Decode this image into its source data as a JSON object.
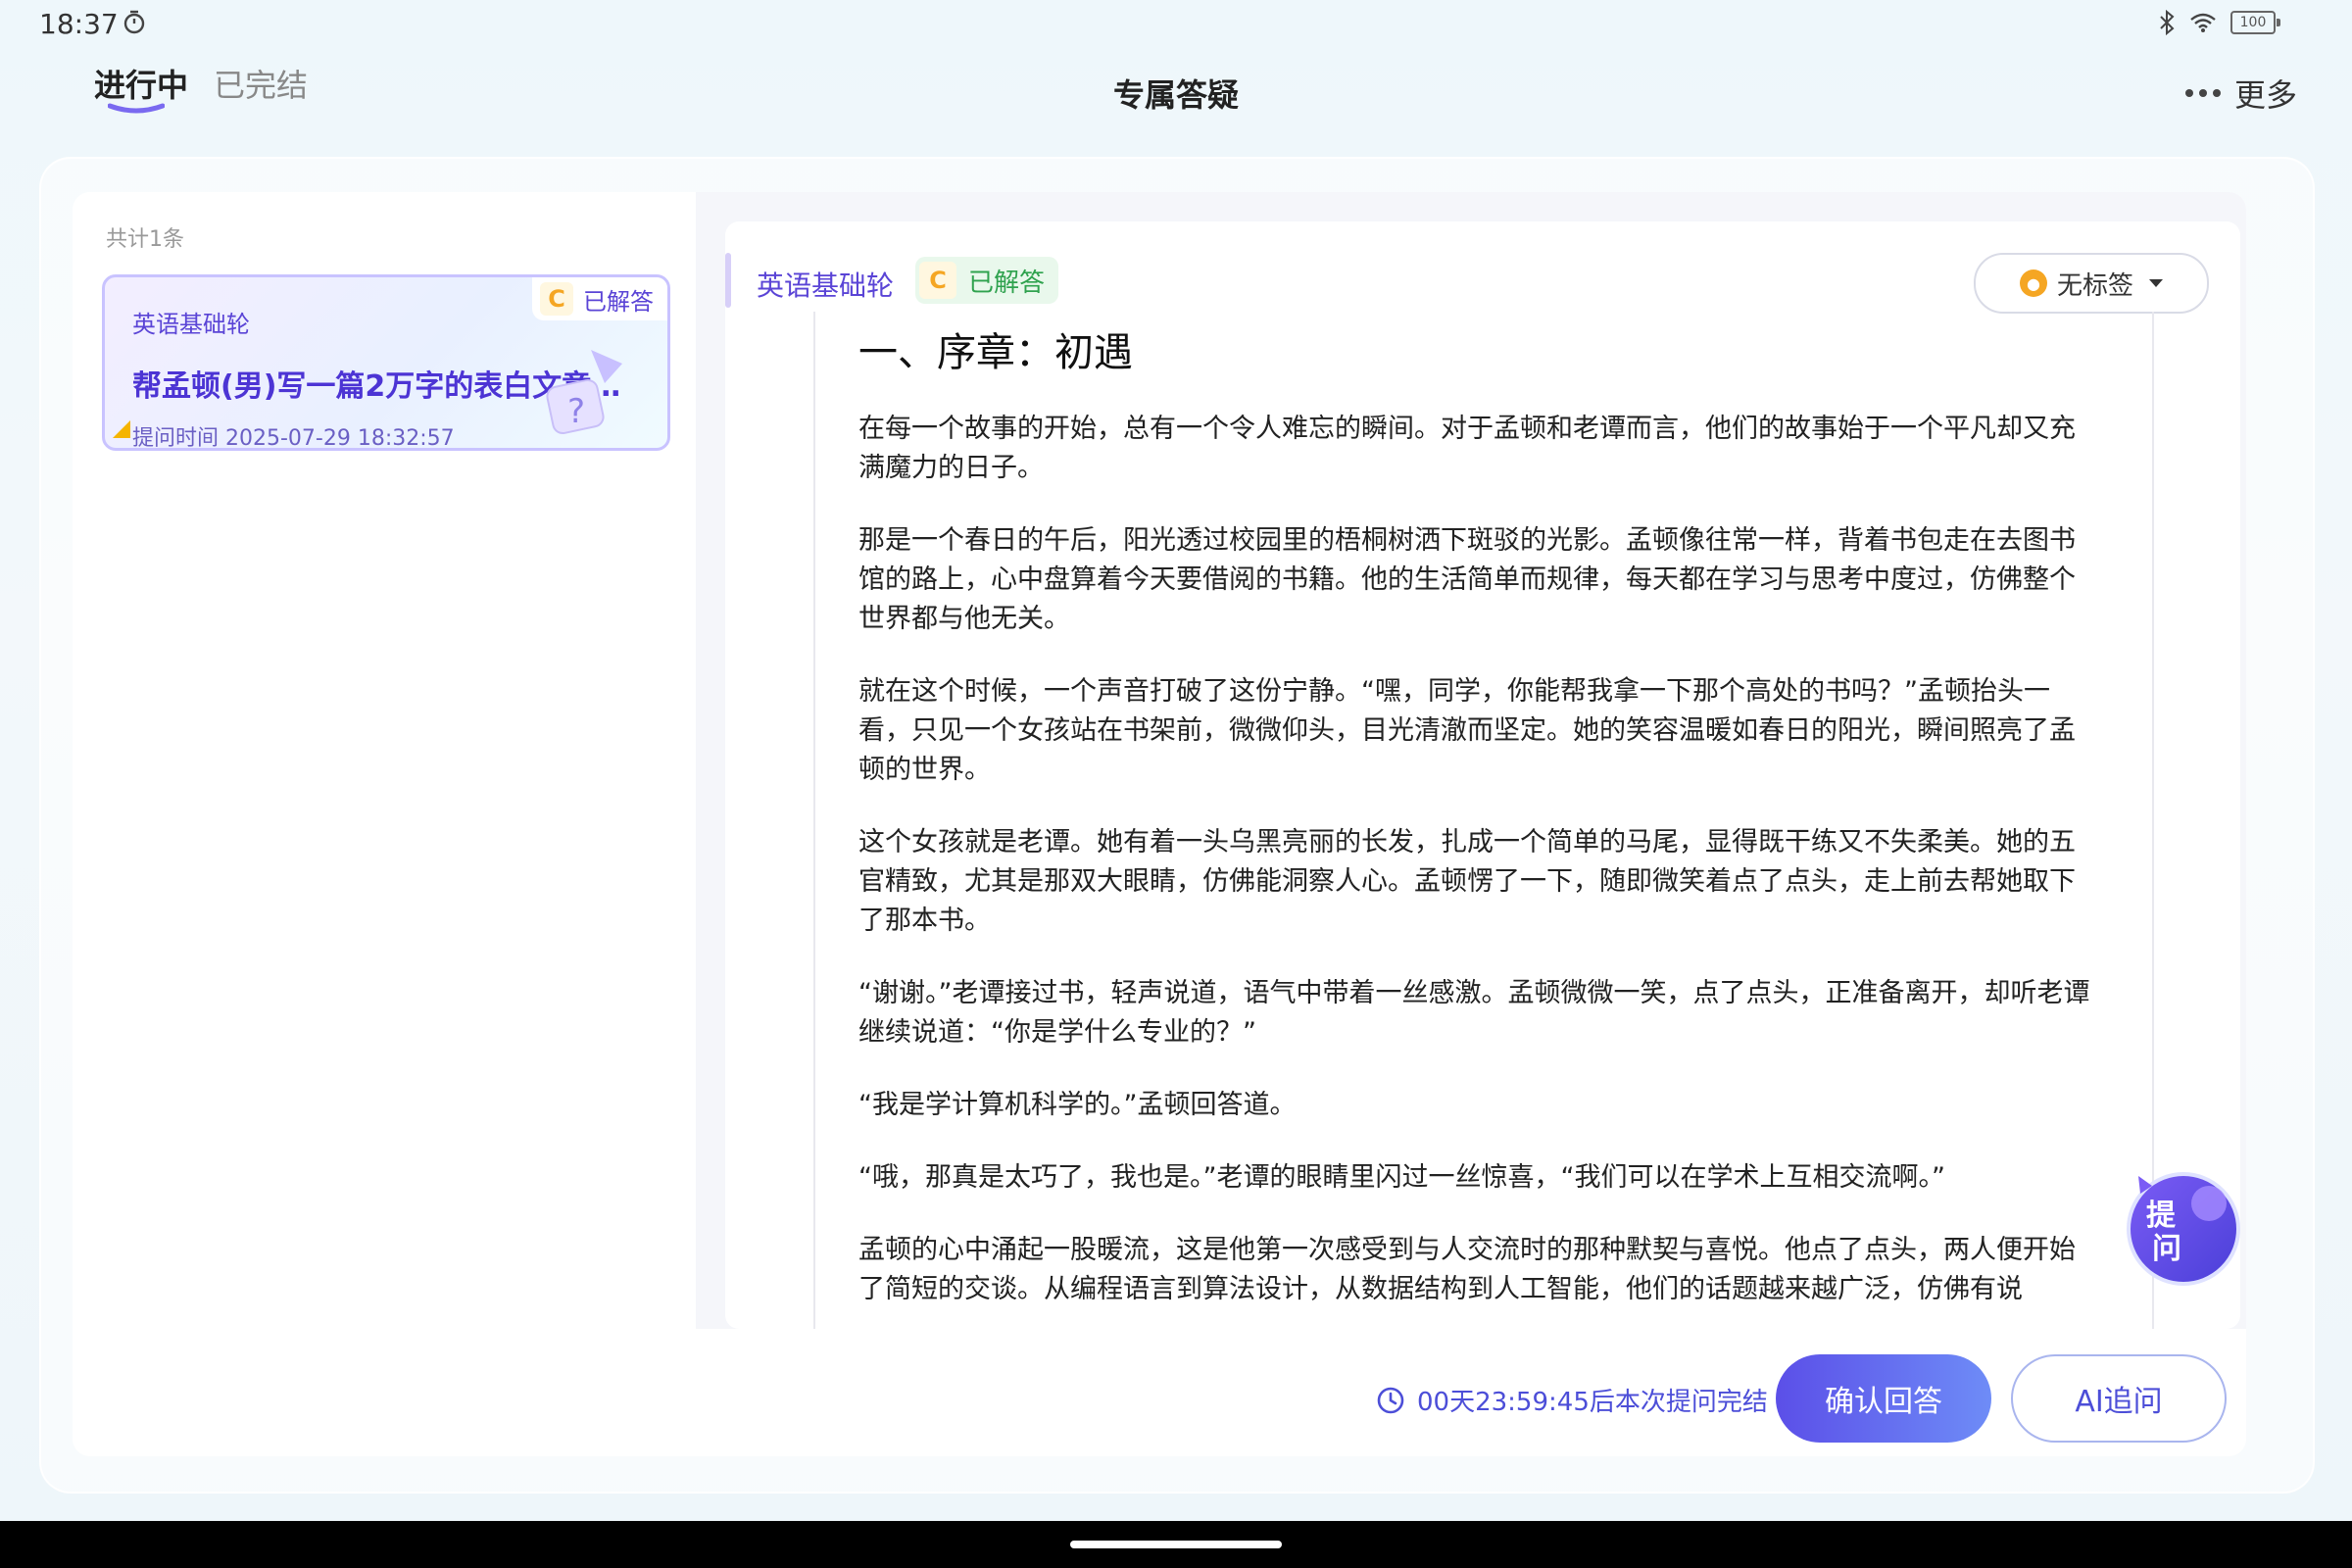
{
  "status_bar": {
    "time": "18:37",
    "battery": "100"
  },
  "header": {
    "tab_active": "进行中",
    "tab_inactive": "已完结",
    "title": "专属答疑",
    "more_label": "更多"
  },
  "list": {
    "count_text": "共计1条",
    "items": [
      {
        "subject": "英语基础轮",
        "status": "已解答",
        "grade_icon": "C",
        "title": "帮孟顿(男)写一篇2万字的表白文章给…",
        "time": "提问时间 2025-07-29 18:32:57"
      }
    ]
  },
  "detail": {
    "subject": "英语基础轮",
    "grade_icon": "C",
    "status": "已解答",
    "tag_label": "无标签",
    "heading": "一、序章：初遇",
    "paragraphs": [
      "在每一个故事的开始，总有一个令人难忘的瞬间。对于孟顿和老谭而言，他们的故事始于一个平凡却又充满魔力的日子。",
      "那是一个春日的午后，阳光透过校园里的梧桐树洒下斑驳的光影。孟顿像往常一样，背着书包走在去图书馆的路上，心中盘算着今天要借阅的书籍。他的生活简单而规律，每天都在学习与思考中度过，仿佛整个世界都与他无关。",
      "就在这个时候，一个声音打破了这份宁静。“嘿，同学，你能帮我拿一下那个高处的书吗？”孟顿抬头一看，只见一个女孩站在书架前，微微仰头，目光清澈而坚定。她的笑容温暖如春日的阳光，瞬间照亮了孟顿的世界。",
      "这个女孩就是老谭。她有着一头乌黑亮丽的长发，扎成一个简单的马尾，显得既干练又不失柔美。她的五官精致，尤其是那双大眼睛，仿佛能洞察人心。孟顿愣了一下，随即微笑着点了点头，走上前去帮她取下了那本书。",
      "“谢谢。”老谭接过书，轻声说道，语气中带着一丝感激。孟顿微微一笑，点了点头，正准备离开，却听老谭继续说道：“你是学什么专业的？”",
      "“我是学计算机科学的。”孟顿回答道。",
      "“哦，那真是太巧了，我也是。”老谭的眼睛里闪过一丝惊喜，“我们可以在学术上互相交流啊。”",
      "孟顿的心中涌起一股暖流，这是他第一次感受到与人交流时的那种默契与喜悦。他点了点头，两人便开始了简短的交谈。从编程语言到算法设计，从数据结构到人工智能，他们的话题越来越广泛，仿佛有说"
    ]
  },
  "fab": {
    "label_line1": "提",
    "label_line2": "问"
  },
  "footer": {
    "countdown": "00天23:59:45后本次提问完结",
    "confirm_label": "确认回答",
    "ai_label": "AI追问"
  },
  "colors": {
    "accent": "#5a44d6",
    "answered_green": "#2fa24e",
    "grade_orange": "#f5a623",
    "button_gradient_start": "#5b4fe8",
    "button_gradient_end": "#6e8cf7"
  }
}
